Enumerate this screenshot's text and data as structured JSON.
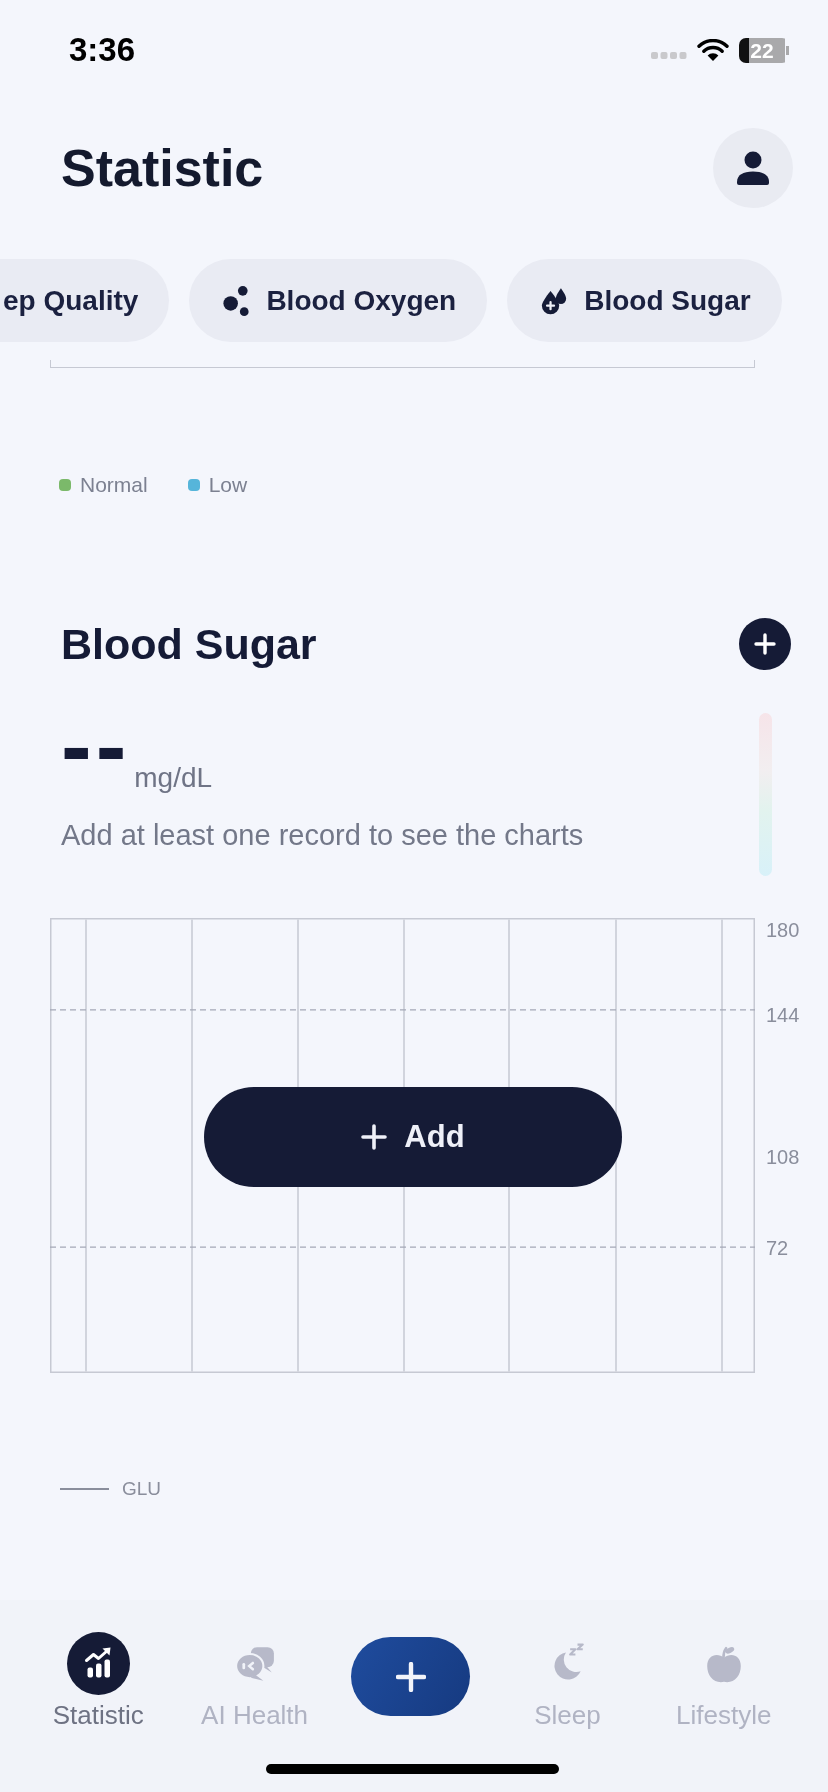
{
  "status_bar": {
    "time": "3:36",
    "battery": "22"
  },
  "header": {
    "title": "Statistic"
  },
  "metric_chips": [
    {
      "label": "ep Quality"
    },
    {
      "kind": "bubbles",
      "label": "Blood Oxygen"
    },
    {
      "kind": "drops",
      "label": "Blood Sugar"
    }
  ],
  "previous_chart_legend": [
    {
      "label": "Normal",
      "color": "#7bb96a"
    },
    {
      "label": "Low",
      "color": "#56b5da"
    }
  ],
  "blood_sugar": {
    "title": "Blood Sugar",
    "value": "--",
    "unit": "mg/dL",
    "hint": "Add at least one record to see the charts",
    "chart": {
      "y_labels": [
        "180",
        "144",
        "108",
        "72"
      ],
      "add_button": "Add",
      "legend": "GLU"
    }
  },
  "tab_bar": {
    "tabs": [
      {
        "kind": "stats",
        "label": "Statistic",
        "selected": true
      },
      {
        "kind": "chat",
        "label": "AI Health",
        "selected": false
      },
      {
        "kind": "sleep",
        "label": "Sleep",
        "selected": false
      },
      {
        "kind": "apple",
        "label": "Lifestyle",
        "selected": false
      }
    ]
  }
}
